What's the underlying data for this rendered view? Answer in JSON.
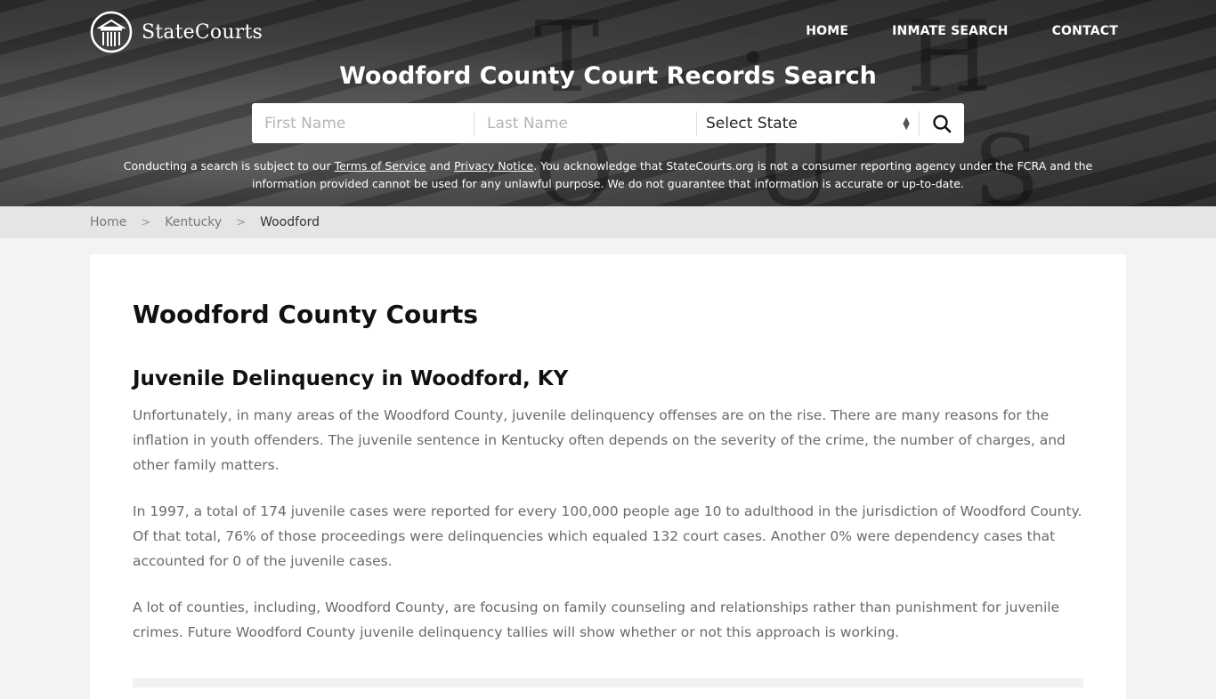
{
  "header": {
    "logo_text": "StateCourts",
    "nav": [
      {
        "label": "HOME"
      },
      {
        "label": "INMATE SEARCH"
      },
      {
        "label": "CONTACT"
      }
    ],
    "title": "Woodford County Court Records Search",
    "background_letters": "T · H O U S E"
  },
  "search": {
    "first_name_placeholder": "First Name",
    "last_name_placeholder": "Last Name",
    "first_name_value": "",
    "last_name_value": "",
    "state_selected": "Select State",
    "search_icon": "search-icon"
  },
  "disclaimer": {
    "part1": "Conducting a search is subject to our ",
    "terms_link": "Terms of Service",
    "part2": " and ",
    "privacy_link": "Privacy Notice",
    "part3": ". You acknowledge that StateCourts.org is not a consumer reporting agency under the FCRA and the information provided cannot be used for any unlawful purpose. We do not guarantee that information is accurate or up-to-date."
  },
  "breadcrumb": [
    {
      "label": "Home"
    },
    {
      "label": "Kentucky"
    },
    {
      "label": "Woodford"
    }
  ],
  "breadcrumb_separator": ">",
  "main": {
    "page_title": "Woodford County Courts",
    "section_title": "Juvenile Delinquency in Woodford, KY",
    "paragraphs": [
      "Unfortunately, in many areas of the Woodford County, juvenile delinquency offenses are on the rise. There are many reasons for the inflation in youth offenders. The juvenile sentence in Kentucky often depends on the severity of the crime, the number of charges, and other family matters.",
      "In 1997, a total of 174 juvenile cases were reported for every 100,000 people age 10 to adulthood in the jurisdiction of Woodford County. Of that total, 76% of those proceedings were delinquencies which equaled 132 court cases. Another 0% were dependency cases that accounted for 0 of the juvenile cases.",
      "A lot of counties, including, Woodford County, are focusing on family counseling and relationships rather than punishment for juvenile crimes. Future Woodford County juvenile delinquency tallies will show whether or not this approach is working."
    ]
  }
}
